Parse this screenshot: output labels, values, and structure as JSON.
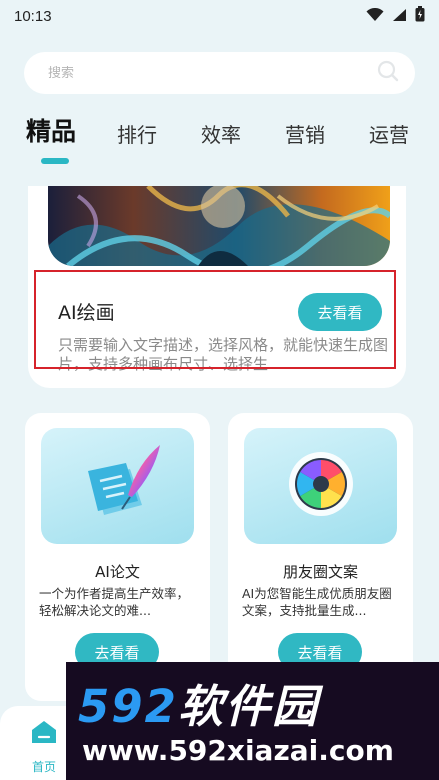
{
  "status_bar": {
    "time": "10:13",
    "icons": [
      "wifi-icon",
      "signal-icon",
      "battery-icon"
    ]
  },
  "search": {
    "placeholder": "搜索",
    "icon": "search-icon"
  },
  "tabs": [
    "精品",
    "排行",
    "效率",
    "营销",
    "运营"
  ],
  "active_tab": "精品",
  "featured": {
    "title": "AI绘画",
    "description": "只需要输入文字描述，选择风格，就能快速生成图片，支持多种画布尺寸、选择生...",
    "button": "去看看"
  },
  "cards": [
    {
      "title": "AI论文",
      "description": "一个为作者提高生产效率，轻松解决论文的难...",
      "button": "去看看",
      "icon": "document-quill-icon"
    },
    {
      "title": "朋友圈文案",
      "description": "AI为您智能生成优质朋友圈文案，支持批量生成...",
      "button": "去看看",
      "icon": "camera-aperture-icon"
    }
  ],
  "bottom_nav": {
    "home_label": "首页",
    "home_icon": "home-icon"
  },
  "watermark": {
    "brand_number": "592",
    "brand_text": "软件园",
    "url": "www.592xiazai.com"
  },
  "colors": {
    "accent": "#30b8c3",
    "background": "#eaf4f7",
    "highlight_border": "#d6232b",
    "watermark_bg": "#160b21",
    "watermark_number": "#2b9af3"
  }
}
